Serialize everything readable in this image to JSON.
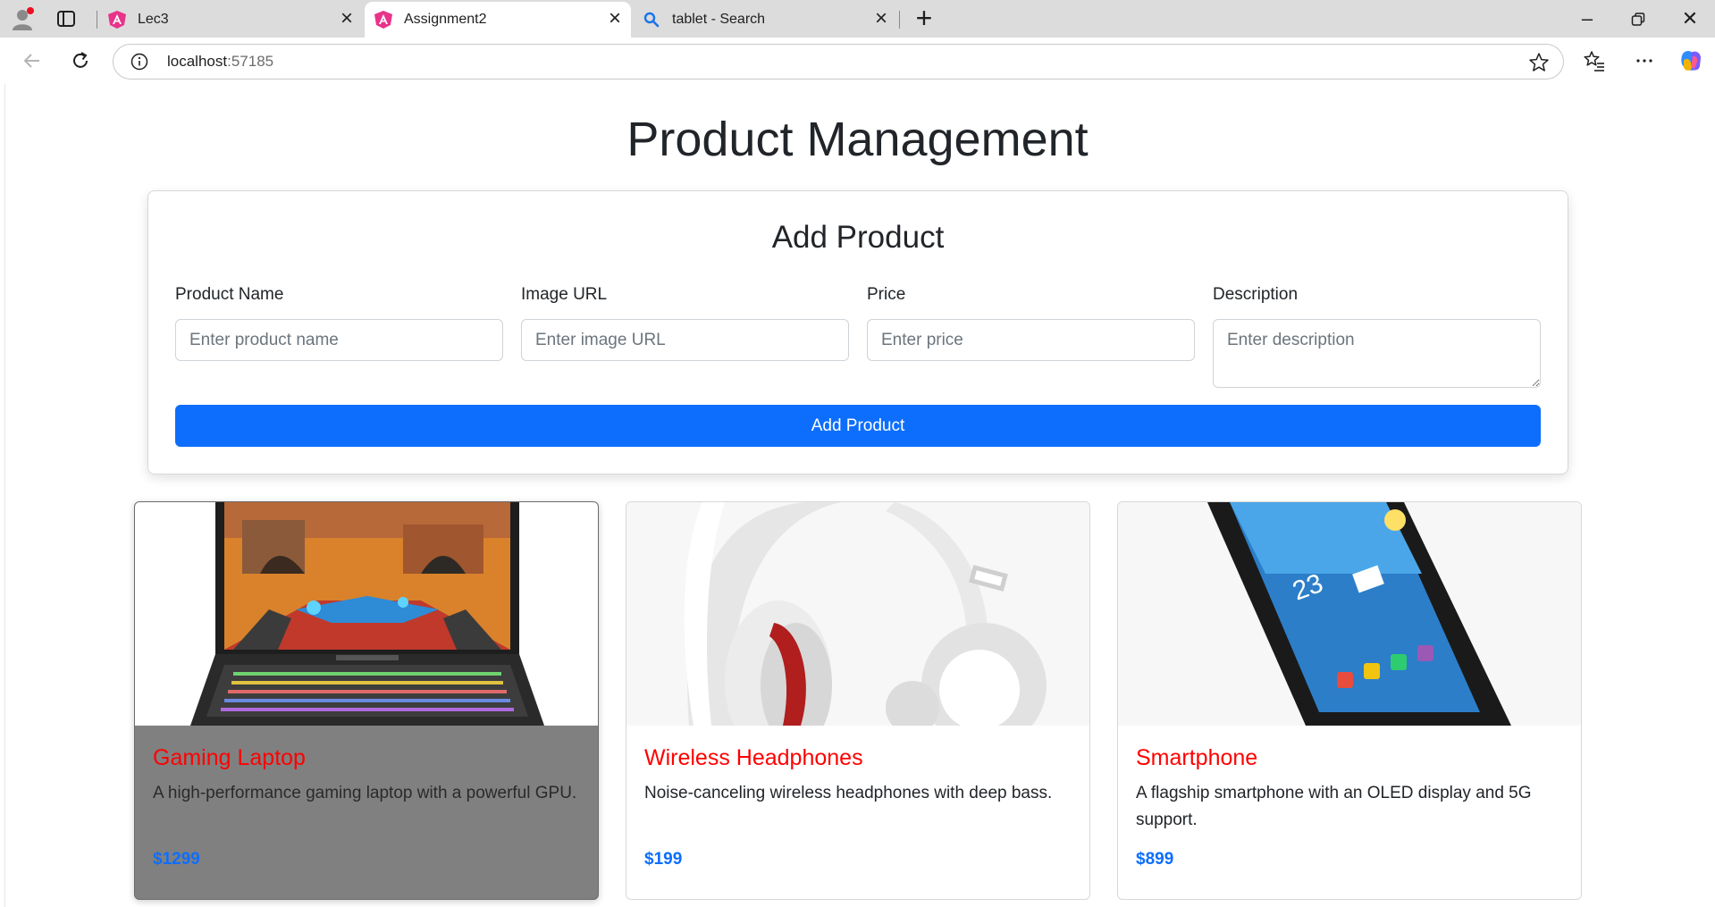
{
  "browser": {
    "tabs": [
      {
        "title": "Lec3",
        "icon": "angular-icon",
        "active": false
      },
      {
        "title": "Assignment2",
        "icon": "angular-icon",
        "active": true
      },
      {
        "title": "tablet - Search",
        "icon": "search-icon",
        "active": false
      }
    ],
    "url_host": "localhost",
    "url_port": ":57185"
  },
  "page": {
    "title": "Product Management"
  },
  "form": {
    "title": "Add Product",
    "fields": [
      {
        "label": "Product Name",
        "placeholder": "Enter product name"
      },
      {
        "label": "Image URL",
        "placeholder": "Enter image URL"
      },
      {
        "label": "Price",
        "placeholder": "Enter price"
      },
      {
        "label": "Description",
        "placeholder": "Enter description"
      }
    ],
    "submit_label": "Add Product"
  },
  "products": [
    {
      "name": "Gaming Laptop",
      "description": "A high-performance gaming laptop with a powerful GPU.",
      "price": "$1299",
      "image": "laptop"
    },
    {
      "name": "Wireless Headphones",
      "description": "Noise-canceling wireless headphones with deep bass.",
      "price": "$199",
      "image": "headphones"
    },
    {
      "name": "Smartphone",
      "description": "A flagship smartphone with an OLED display and 5G support.",
      "price": "$899",
      "image": "tablet-phone"
    }
  ],
  "colors": {
    "primary": "#0d6efd",
    "product_name": "#ff0000",
    "hover_card": "#808080"
  }
}
